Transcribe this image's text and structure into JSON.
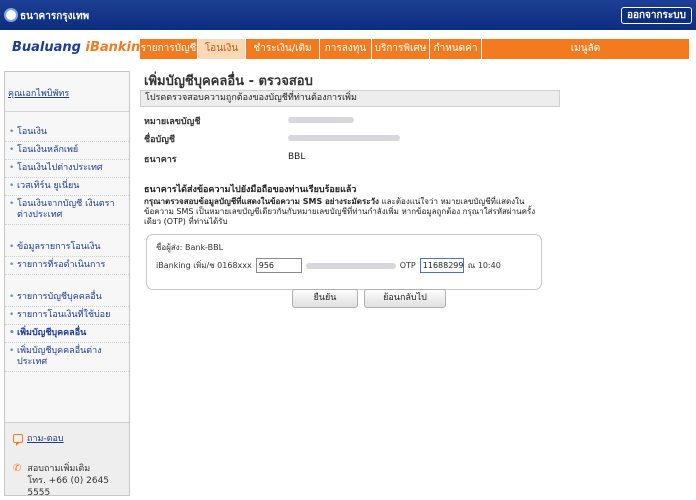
{
  "header": {
    "bank_name": "ธนาคารกรุงเทพ",
    "logout_label": "ออกจากระบบ"
  },
  "brand": {
    "part1": "Bualuang ",
    "part2": "iBanking"
  },
  "nav": {
    "items": [
      {
        "label": "รายการบัญชี"
      },
      {
        "label": "โอนเงิน",
        "active": true
      },
      {
        "label": "ชำระเงิน/เติมเงิน"
      },
      {
        "label": "การลงทุน"
      },
      {
        "label": "บริการพิเศษ"
      },
      {
        "label": "กำหนดค่า"
      },
      {
        "label": "เมนูลัด"
      }
    ]
  },
  "sidebar": {
    "header": "คุณเอกไพบิพัทร",
    "items": [
      {
        "label": "โอนเงิน"
      },
      {
        "label": "โอนเงินหลักเพย์"
      },
      {
        "label": "โอนเงินไปต่างประเทศ"
      },
      {
        "label": "เวสเทิร์น ยูเนี่ยน"
      },
      {
        "label": "โอนเงินจากบัญชี เงินตราต่างประเทศ"
      },
      {
        "label": "ข้อมูลรายการโอนเงิน"
      },
      {
        "label": "รายการที่รอดำเนินการ"
      },
      {
        "label": "รายการบัญชีบุคคลอื่น"
      },
      {
        "label": "รายการโอนเงินที่ใช้บ่อย"
      },
      {
        "label": "เพิ่มบัญชีบุคคลอื่น",
        "active": true
      },
      {
        "label": "เพิ่มบัญชีบุคคลอื่นต่างประเทศ"
      }
    ],
    "qa_label": "ถาม-ตอบ",
    "contact_line1": "สอบถามเพิ่มเติม",
    "contact_line2": "โทร. +66 (0) 2645 5555"
  },
  "main": {
    "title": "เพิ่มบัญชีบุคคลอื่น - ตรวจสอบ",
    "instruction": "โปรดตรวจสอบความถูกต้องของบัญชีที่ท่านต้องการเพิ่ม",
    "fields": [
      {
        "label": "หมายเลขบัญชี",
        "value": ""
      },
      {
        "label": "ชื่อบัญชี",
        "value": ""
      },
      {
        "label": "ธนาคาร",
        "value": "BBL"
      }
    ],
    "sms_title": "ธนาคารได้ส่งข้อความไปยังมือถือของท่านเรียบร้อยแล้ว",
    "note_bold": "กรุณาตรวจสอบข้อมูลบัญชีที่แสดงในข้อความ SMS อย่างระมัดระวัง",
    "note_rest": " และต้องแน่ใจว่า หมายเลขบัญชีที่แสดงในข้อความ SMS เป็นหมายเลขบัญชีเดียวกันกับหมายเลขบัญชีที่ท่านกำลังเพิ่ม หากข้อมูลถูกต้อง กรุณาใส่รหัสผ่านครั้งเดียว (OTP) ที่ท่านได้รับ",
    "sender": "ชื่อผู้ส่ง: Bank-BBL",
    "otp_prefix": "iBanking เพิ่ม/ช 0168xxx",
    "ref_value": "956",
    "otp_label": "OTP",
    "otp_value": "11688299",
    "time_text": "ณ 10:40",
    "confirm_label": "ยืนยัน",
    "back_label": "ย้อนกลับไป"
  }
}
